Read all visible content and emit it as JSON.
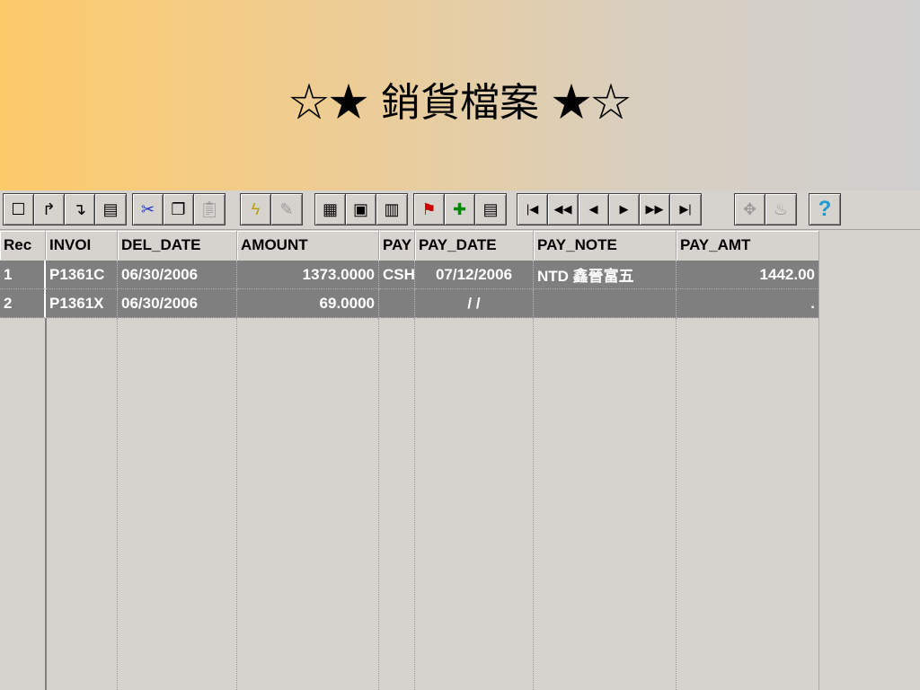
{
  "slide": {
    "title": "☆★ 銷貨檔案 ★☆"
  },
  "toolbar": {
    "groups": [
      [
        "new-icon",
        "open-icon",
        "save-icon",
        "print-icon"
      ],
      [
        "cut-icon",
        "copy-icon",
        "paste-icon"
      ],
      [
        "run-icon",
        "design-icon"
      ],
      [
        "browse-icon",
        "edit-icon",
        "form-icon"
      ],
      [
        "filter-icon",
        "append-icon",
        "layout-icon"
      ],
      [
        "first-icon",
        "prev-page-icon",
        "prev-icon",
        "next-icon",
        "next-page-icon",
        "last-icon"
      ],
      [
        "navigator-icon",
        "wizard-icon"
      ],
      [
        "help-icon"
      ]
    ]
  },
  "grid": {
    "columns": [
      "Rec",
      "INVOI",
      "DEL_DATE",
      "AMOUNT",
      "PAY",
      "PAY_DATE",
      "PAY_NOTE",
      "PAY_AMT"
    ],
    "rows": [
      [
        "1",
        "P1361C",
        "06/30/2006",
        "1373.0000",
        "CSH",
        "07/12/2006",
        "NTD 鑫晉富五",
        "1442.00"
      ],
      [
        "2",
        "P1361X",
        "06/30/2006",
        "69.0000",
        "",
        "/  /",
        "",
        "."
      ]
    ]
  }
}
